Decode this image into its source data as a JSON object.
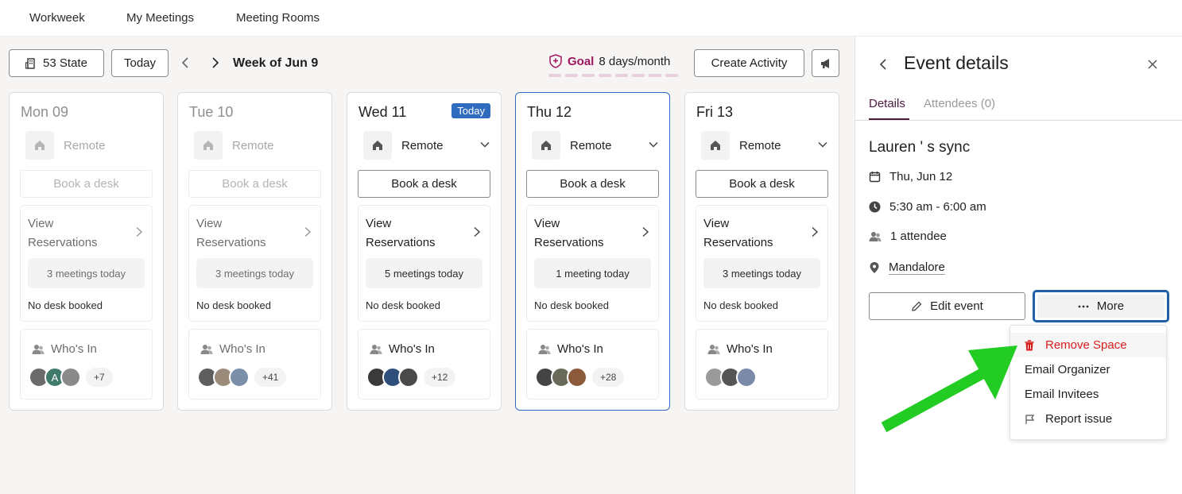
{
  "nav": {
    "tabs": [
      "Workweek",
      "My Meetings",
      "Meeting Rooms"
    ]
  },
  "toolbar": {
    "location": "53 State",
    "today": "Today",
    "week_title": "Week of Jun 9",
    "goal_label": "Goal",
    "goal_value": "8 days/month",
    "goal_segments": 8,
    "create_activity": "Create Activity"
  },
  "days": [
    {
      "name": "Mon 09",
      "past": true,
      "status": "Remote",
      "book": "Book a desk",
      "res_title": "View Reservations",
      "meetings": "3 meetings today",
      "desk": "No desk booked",
      "who": "Who's In",
      "more": "+7"
    },
    {
      "name": "Tue 10",
      "past": true,
      "status": "Remote",
      "book": "Book a desk",
      "res_title": "View Reservations",
      "meetings": "3 meetings today",
      "desk": "No desk booked",
      "who": "Who's In",
      "more": "+41"
    },
    {
      "name": "Wed 11",
      "badge": "Today",
      "status": "Remote",
      "book": "Book a desk",
      "res_title": "View Reservations",
      "meetings": "5 meetings today",
      "desk": "No desk booked",
      "who": "Who's In",
      "more": "+12"
    },
    {
      "name": "Thu 12",
      "status": "Remote",
      "book": "Book a desk",
      "res_title": "View Reservations",
      "meetings": "1 meeting today",
      "desk": "No desk booked",
      "who": "Who's In",
      "more": "+28"
    },
    {
      "name": "Fri 13",
      "status": "Remote",
      "book": "Book a desk",
      "res_title": "View Reservations",
      "meetings": "3 meetings today",
      "desk": "No desk booked",
      "who": "Who's In"
    }
  ],
  "panel": {
    "title": "Event details",
    "tab_details": "Details",
    "tab_attendees": "Attendees (0)",
    "event_title": "Lauren ' s sync",
    "date": "Thu, Jun 12",
    "time": "5:30 am - 6:00 am",
    "attendees": "1 attendee",
    "location": "Mandalore",
    "edit": "Edit event",
    "more": "More",
    "menu": [
      "Remove Space",
      "Email Organizer",
      "Email Invitees",
      "Report issue"
    ]
  },
  "colors": {
    "accent_blue": "#2f6bbf",
    "goal_pink": "#a0165e",
    "danger_red": "#d91c1c",
    "annotation_green": "#22cc22"
  }
}
